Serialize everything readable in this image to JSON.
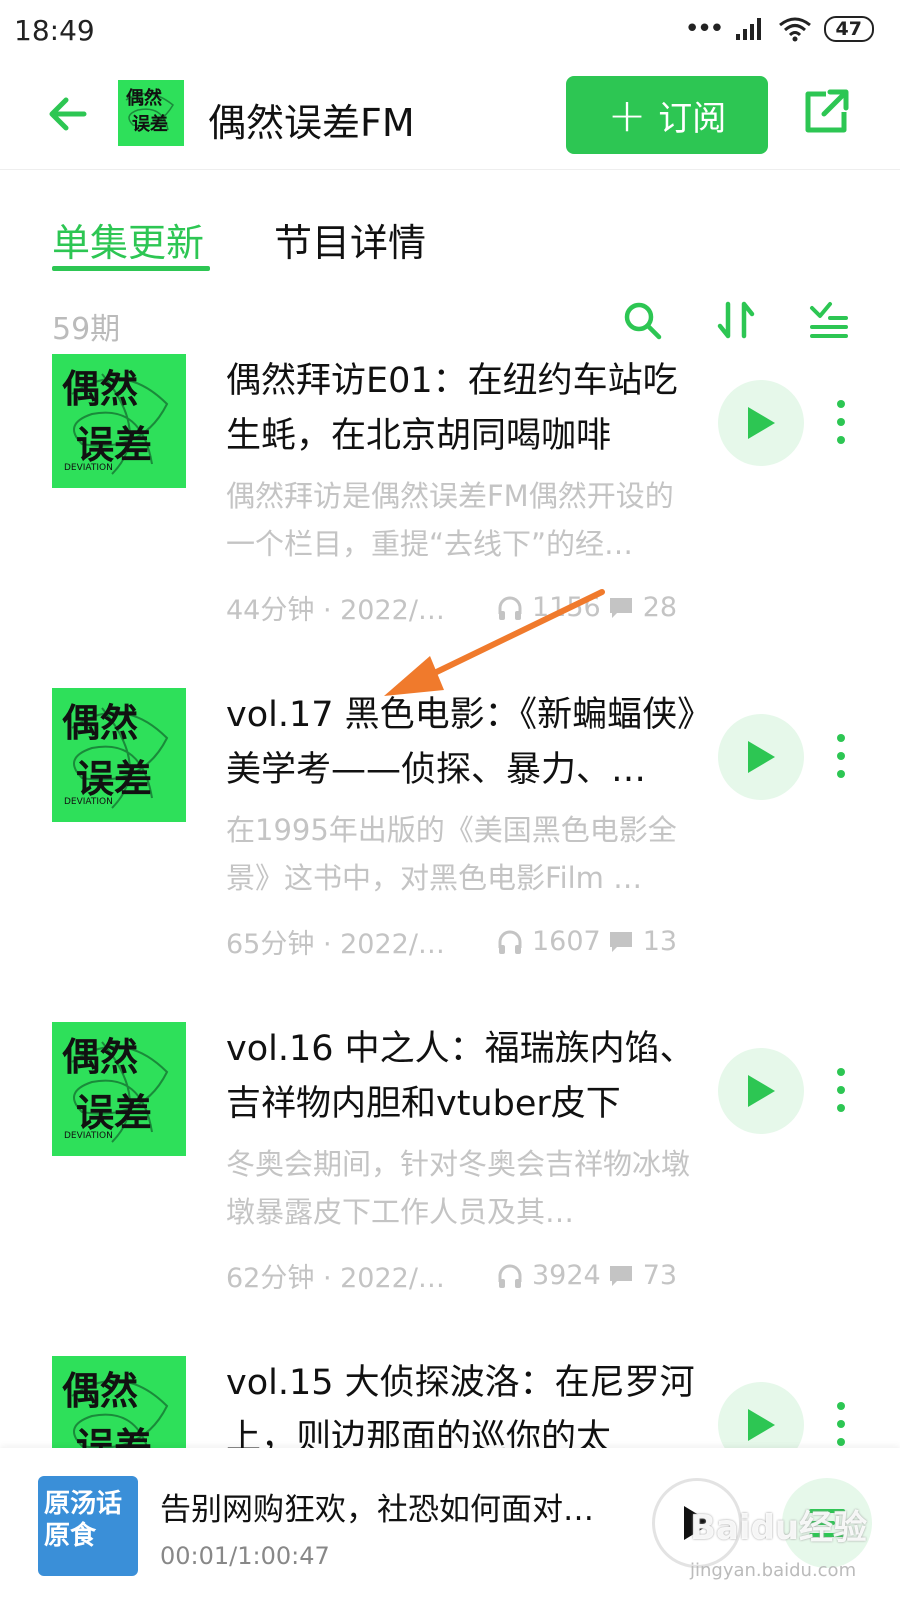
{
  "status_bar": {
    "time": "18:49",
    "battery": "47",
    "signal_dots": "•••"
  },
  "header": {
    "title": "偶然误差FM",
    "subscribe_label": "订阅",
    "subscribe_plus": "+"
  },
  "tabs": [
    {
      "label": "单集更新",
      "active": true
    },
    {
      "label": "节目详情",
      "active": false
    }
  ],
  "toolbar": {
    "count": "59期"
  },
  "episodes": [
    {
      "title": "偶然拜访E01：在纽约车站吃生蚝，在北京胡同喝咖啡",
      "description": "偶然拜访是偶然误差FM偶然开设的一个栏目，重提“去线下”的经…",
      "date": "44分钟 · 2022/0...",
      "listens": "1156",
      "comments": "28"
    },
    {
      "title": "vol.17 黑色电影：《新蝙蝠侠》美学考——侦探、暴力、…",
      "description": "在1995年出版的《美国黑色电影全景》这书中，对黑色电影Film …",
      "date": "65分钟 · 2022/0...",
      "listens": "1607",
      "comments": "13"
    },
    {
      "title": "vol.16 中之人：福瑞族内馅、吉祥物内胆和vtuber皮下",
      "description": "冬奥会期间，针对冬奥会吉祥物冰墩墩暴露皮下工作人员及其…",
      "date": "62分钟 · 2022/0...",
      "listens": "3924",
      "comments": "73"
    },
    {
      "title": "vol.15 大侦探波洛：在尼罗河上，则边那面的巡你的太",
      "description": "",
      "date": "",
      "listens": "",
      "comments": ""
    }
  ],
  "player": {
    "title": "告别网购狂欢，社恐如何面对…",
    "time": "00:01/1:00:47",
    "cover_text": "原汤话原食"
  },
  "watermark": {
    "brand": "Baidu经验",
    "url": "jingyan.baidu.com"
  },
  "colors": {
    "accent": "#2dc653",
    "accent_light": "#e6f8ea",
    "annotation_arrow": "#f07a2c",
    "cover_green": "#2ee05a"
  },
  "icons": [
    "back-arrow-icon",
    "share-icon",
    "search-icon",
    "sort-icon",
    "filter-list-icon",
    "play-icon",
    "more-vertical-icon",
    "headphones-icon",
    "comment-icon",
    "playlist-icon",
    "wifi-icon",
    "signal-icon"
  ]
}
